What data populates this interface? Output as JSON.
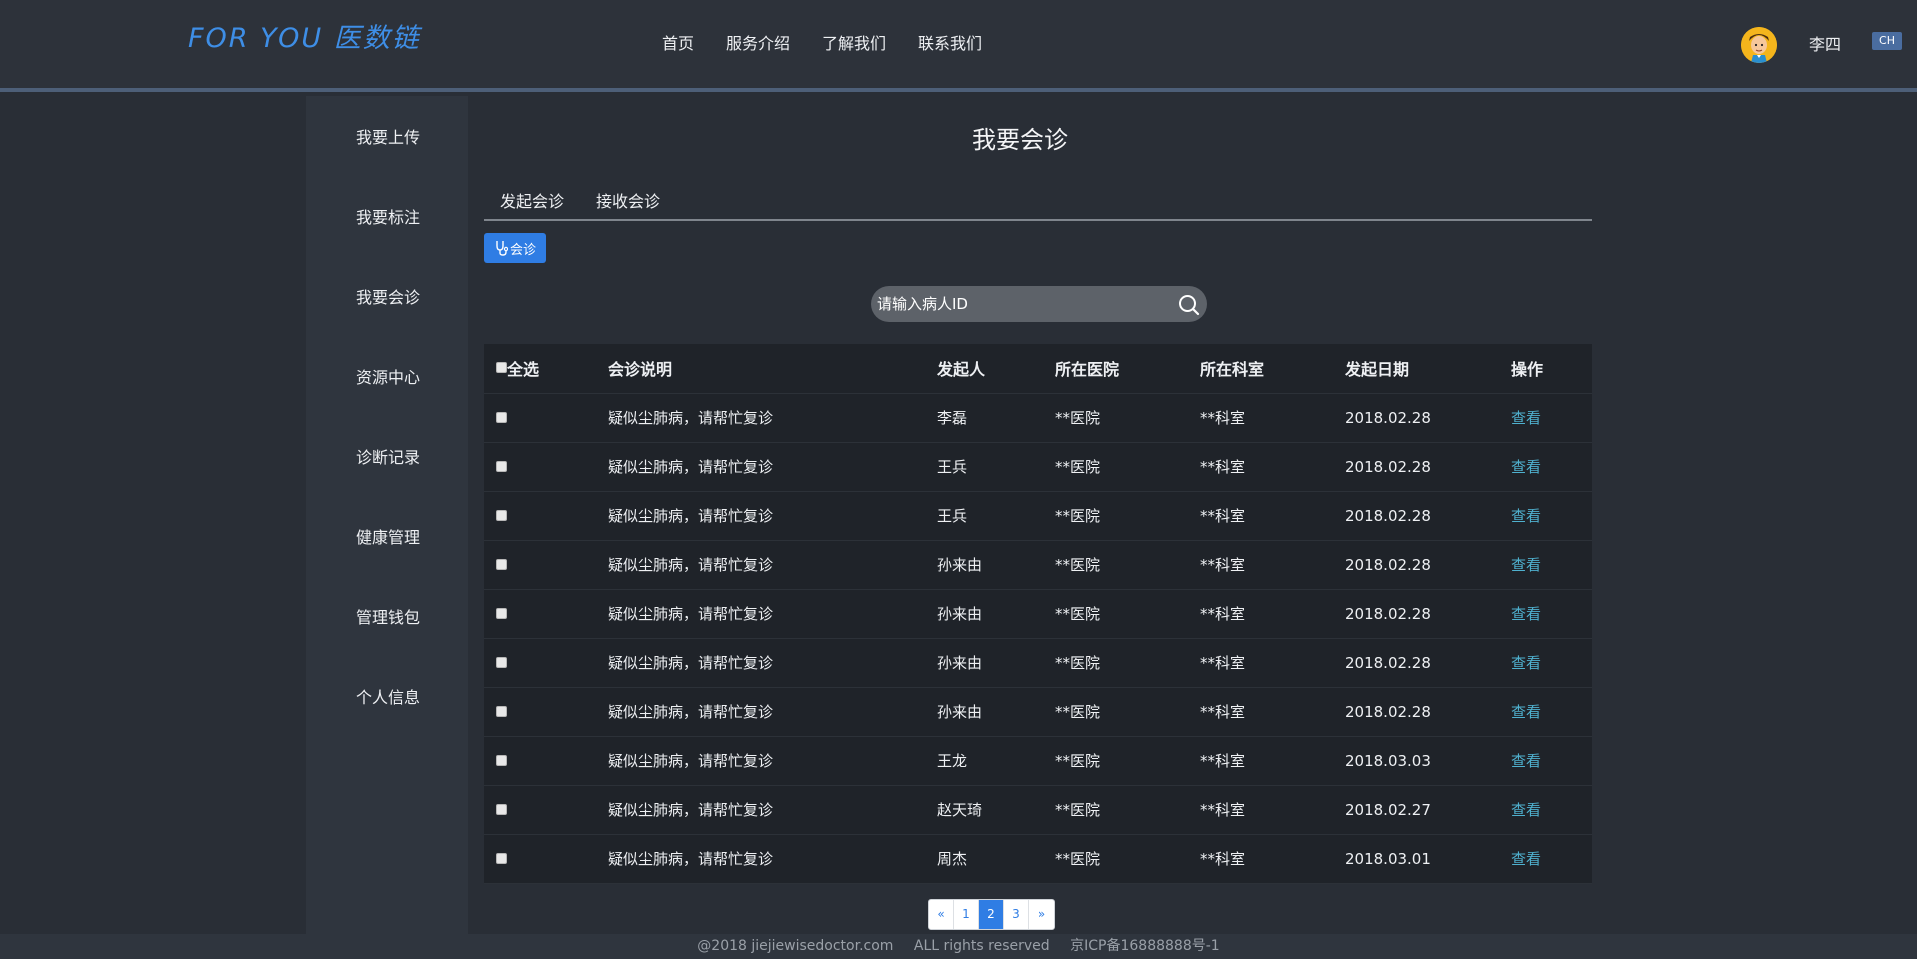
{
  "header": {
    "logo": "FOR YOU 医数链",
    "nav": [
      "首页",
      "服务介绍",
      "了解我们",
      "联系我们"
    ],
    "username": "李四",
    "lang": "CH"
  },
  "sidebar": {
    "items": [
      "我要上传",
      "我要标注",
      "我要会诊",
      "资源中心",
      "诊断记录",
      "健康管理",
      "管理钱包",
      "个人信息"
    ]
  },
  "main": {
    "title": "我要会诊",
    "tabs": [
      "发起会诊",
      "接收会诊"
    ],
    "consult_button": "会诊",
    "search": {
      "placeholder": "请输入病人ID"
    },
    "table": {
      "headers": [
        "全选",
        "会诊说明",
        "发起人",
        "所在医院",
        "所在科室",
        "发起日期",
        "操作"
      ],
      "rows": [
        {
          "desc": "疑似尘肺病，请帮忙复诊",
          "initiator": "李磊",
          "hospital": "**医院",
          "dept": "**科室",
          "date": "2018.02.28",
          "action": "查看"
        },
        {
          "desc": "疑似尘肺病，请帮忙复诊",
          "initiator": "王兵",
          "hospital": "**医院",
          "dept": "**科室",
          "date": "2018.02.28",
          "action": "查看"
        },
        {
          "desc": "疑似尘肺病，请帮忙复诊",
          "initiator": "王兵",
          "hospital": "**医院",
          "dept": "**科室",
          "date": "2018.02.28",
          "action": "查看"
        },
        {
          "desc": "疑似尘肺病，请帮忙复诊",
          "initiator": "孙来由",
          "hospital": "**医院",
          "dept": "**科室",
          "date": "2018.02.28",
          "action": "查看"
        },
        {
          "desc": "疑似尘肺病，请帮忙复诊",
          "initiator": "孙来由",
          "hospital": "**医院",
          "dept": "**科室",
          "date": "2018.02.28",
          "action": "查看"
        },
        {
          "desc": "疑似尘肺病，请帮忙复诊",
          "initiator": "孙来由",
          "hospital": "**医院",
          "dept": "**科室",
          "date": "2018.02.28",
          "action": "查看"
        },
        {
          "desc": "疑似尘肺病，请帮忙复诊",
          "initiator": "孙来由",
          "hospital": "**医院",
          "dept": "**科室",
          "date": "2018.02.28",
          "action": "查看"
        },
        {
          "desc": "疑似尘肺病，请帮忙复诊",
          "initiator": "王龙",
          "hospital": "**医院",
          "dept": "**科室",
          "date": "2018.03.03",
          "action": "查看"
        },
        {
          "desc": "疑似尘肺病，请帮忙复诊",
          "initiator": "赵天琦",
          "hospital": "**医院",
          "dept": "**科室",
          "date": "2018.02.27",
          "action": "查看"
        },
        {
          "desc": "疑似尘肺病，请帮忙复诊",
          "initiator": "周杰",
          "hospital": "**医院",
          "dept": "**科室",
          "date": "2018.03.01",
          "action": "查看"
        }
      ]
    },
    "pagination": {
      "prev": "«",
      "pages": [
        "1",
        "2",
        "3"
      ],
      "current": "2",
      "next": "»"
    }
  },
  "footer": {
    "copyright": "@2018 jiejiewisedoctor.com",
    "rights": "ALL rights reserved",
    "icp": "京ICP备16888888号-1"
  },
  "colors": {
    "accent": "#2f7de4",
    "link": "#4fb1cf",
    "logo": "#3e8ee6"
  }
}
